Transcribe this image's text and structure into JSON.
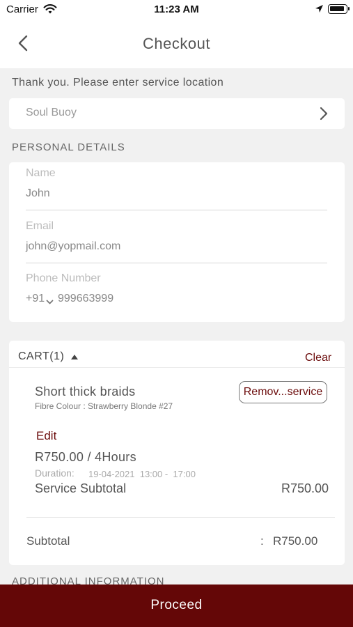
{
  "status_bar": {
    "carrier": "Carrier",
    "time": "11:23 AM",
    "icons": [
      "wifi-icon",
      "location-arrow-icon",
      "battery-icon"
    ]
  },
  "header": {
    "title": "Checkout",
    "back_icon": "chevron-left-icon"
  },
  "location": {
    "prompt": "Thank you. Please enter service location",
    "value": "Soul Buoy",
    "icon": "chevron-right-icon"
  },
  "personal": {
    "section_title": "PERSONAL DETAILS",
    "name_label": "Name",
    "name_value": "John",
    "email_label": "Email",
    "email_value": "john@yopmail.com",
    "phone_label": "Phone Number",
    "country_code": "+91",
    "phone_value": "999663999"
  },
  "cart": {
    "title": "CART(1)",
    "clear_label": "Clear",
    "item": {
      "name": "Short thick braids",
      "colour": "Fibre Colour : Strawberry Blonde #27",
      "remove_label": "Remov...service",
      "edit_label": "Edit",
      "price": "R750.00 / 4Hours",
      "duration_label": "Duration:",
      "duration_value": "19-04-2021  13:00 -  17:00",
      "service_subtotal_label": "Service Subtotal",
      "service_subtotal_value": "R750.00"
    },
    "subtotal_label": "Subtotal",
    "subtotal_colon": ":",
    "subtotal_value": "R750.00"
  },
  "additional_title": "ADDITIONAL INFORMATION",
  "proceed_label": "Proceed",
  "colors": {
    "accent": "#640707",
    "accent_text": "#6b0b0b",
    "background": "#f1f1f1"
  }
}
